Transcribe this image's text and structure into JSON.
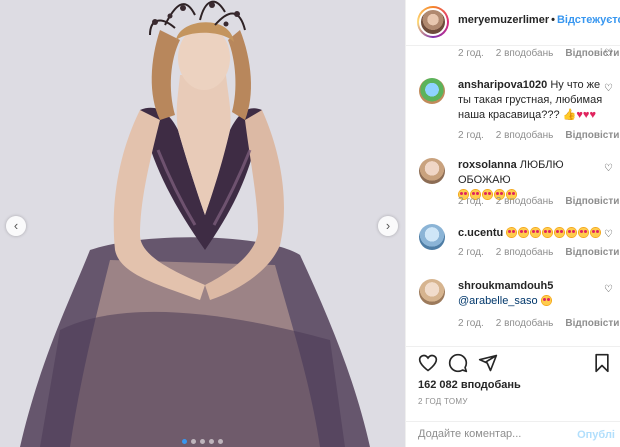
{
  "post": {
    "username": "meryemuzerlimer",
    "separator": "•",
    "follow_label": "Відстежуєтс",
    "likes_text": "162 082 вподобань",
    "time_text": "2 ГОД ТОМУ",
    "comment_placeholder": "Додайте коментар...",
    "post_label": "Опублі",
    "carousel_dots": 5,
    "carousel_active": 0
  },
  "first_meta": {
    "time": "2 год.",
    "likes": "2 вподобань",
    "reply": "Відповісти"
  },
  "comments": [
    {
      "username": "ansharipova1020",
      "text": "Ну что же ты такая грустная, любимая наша красавица???",
      "emojis": [
        "thumb-emoji",
        "heart-emoji",
        "heart-emoji",
        "heart-emoji"
      ],
      "time": "2 год.",
      "likes": "2 вподобань",
      "reply": "Відповісти"
    },
    {
      "username": "roxsolanna",
      "text": "ЛЮБЛЮ ОБОЖАЮ",
      "emojis": [
        "heart-eyes-emoji",
        "heart-eyes-emoji",
        "heart-eyes-emoji",
        "heart-eyes-emoji",
        "heart-eyes-emoji"
      ],
      "time": "2 год.",
      "likes": "2 вподобань",
      "reply": "Відповісти"
    },
    {
      "username": "c.ucentu",
      "text": "",
      "emojis": [
        "heart-eyes-emoji",
        "heart-eyes-emoji",
        "heart-eyes-emoji",
        "heart-eyes-emoji",
        "heart-eyes-emoji",
        "heart-eyes-emoji",
        "heart-eyes-emoji",
        "heart-eyes-emoji"
      ],
      "time": "2 год.",
      "likes": "2 вподобань",
      "reply": "Відповісти"
    },
    {
      "username": "shroukmamdouh5",
      "mention": "@arabelle_saso",
      "emojis": [
        "heart-eyes-emoji"
      ],
      "time": "2 год.",
      "likes": "2 вподобань",
      "reply": "Відповісти"
    }
  ],
  "icons": {
    "like": "heart-icon",
    "comment": "comment-icon",
    "share": "share-icon",
    "save": "bookmark-icon",
    "prev": "chevron-left-icon",
    "next": "chevron-right-icon",
    "comment_like": "small-heart-icon"
  },
  "colors": {
    "link": "#3897f0",
    "meta": "#8e8e8e",
    "text": "#262626",
    "heart": "#e0245e"
  }
}
